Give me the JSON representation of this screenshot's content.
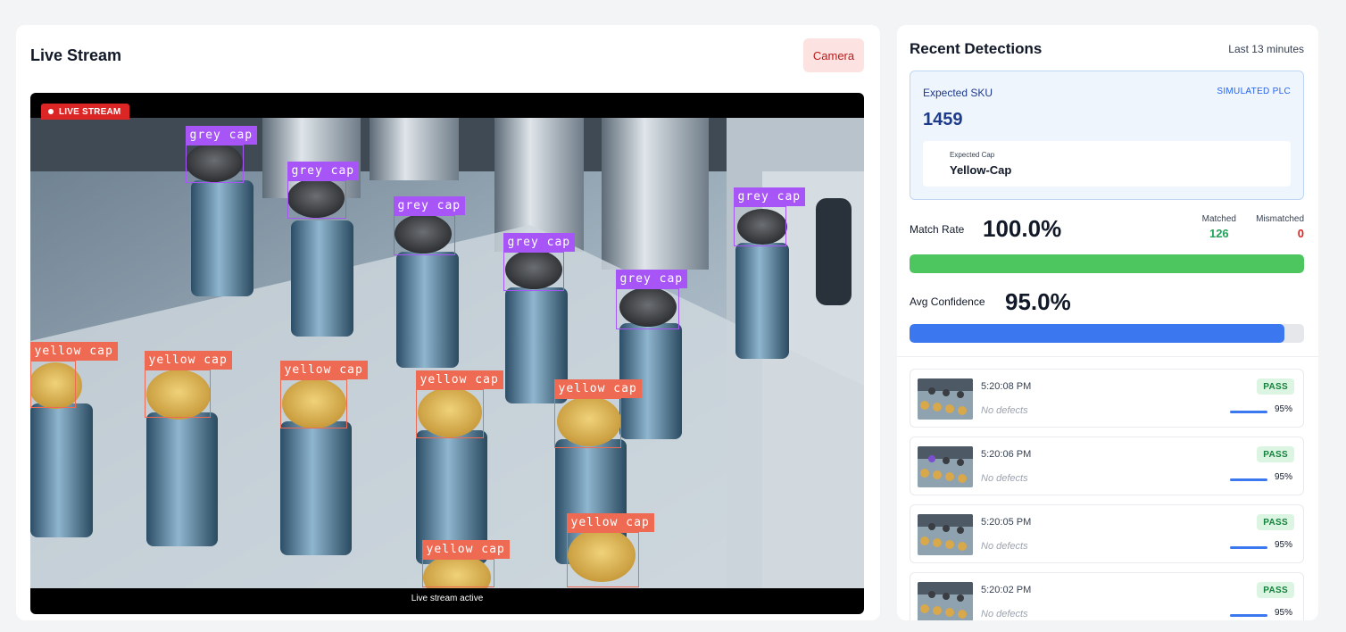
{
  "left": {
    "title": "Live Stream",
    "camera_button": "Camera",
    "live_badge": "LIVE STREAM",
    "status": "Live stream active",
    "detections": [
      {
        "label": "grey cap",
        "class": "grey"
      },
      {
        "label": "grey cap",
        "class": "grey"
      },
      {
        "label": "grey cap",
        "class": "grey"
      },
      {
        "label": "grey cap",
        "class": "grey"
      },
      {
        "label": "grey cap",
        "class": "grey"
      },
      {
        "label": "grey cap",
        "class": "grey"
      },
      {
        "label": "yellow cap",
        "class": "yellow"
      },
      {
        "label": "yellow cap",
        "class": "yellow"
      },
      {
        "label": "yellow cap",
        "class": "yellow"
      },
      {
        "label": "yellow cap",
        "class": "yellow"
      },
      {
        "label": "yellow cap",
        "class": "yellow"
      },
      {
        "label": "yellow cap",
        "class": "yellow"
      },
      {
        "label": "yellow cap",
        "class": "yellow"
      }
    ]
  },
  "right": {
    "title": "Recent Detections",
    "subtitle": "Last 13 minutes",
    "sku": {
      "label": "Expected SKU",
      "source": "SIMULATED PLC",
      "value": "1459",
      "cap_label": "Expected Cap",
      "cap_value": "Yellow-Cap"
    },
    "match": {
      "label": "Match Rate",
      "value": "100.0%",
      "fraction": 1.0,
      "matched_label": "Matched",
      "matched": "126",
      "mismatched_label": "Mismatched",
      "mismatched": "0"
    },
    "confidence": {
      "label": "Avg Confidence",
      "value": "95.0%",
      "fraction": 0.95
    },
    "items": [
      {
        "time": "5:20:08 PM",
        "defects": "No defects",
        "status": "PASS",
        "confidence": "95%"
      },
      {
        "time": "5:20:06 PM",
        "defects": "No defects",
        "status": "PASS",
        "confidence": "95%"
      },
      {
        "time": "5:20:05 PM",
        "defects": "No defects",
        "status": "PASS",
        "confidence": "95%"
      },
      {
        "time": "5:20:02 PM",
        "defects": "No defects",
        "status": "PASS",
        "confidence": "95%"
      }
    ]
  },
  "colors": {
    "grey_cap_box": "#a855f7",
    "yellow_cap_box": "#ef6a53",
    "pass_badge": "#16803c",
    "match_bar": "#4ec65f",
    "confidence_bar": "#3b78ef"
  }
}
